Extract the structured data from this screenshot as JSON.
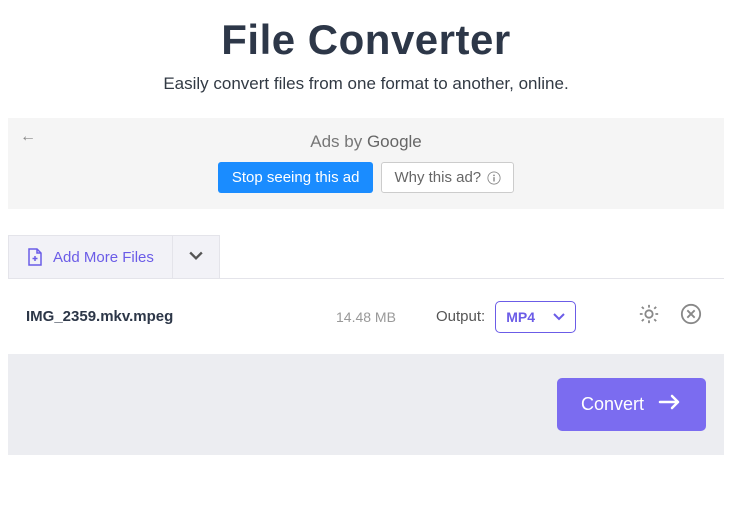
{
  "header": {
    "title": "File Converter",
    "subtitle": "Easily convert files from one format to another, online."
  },
  "ad": {
    "ads_by": "Ads by ",
    "google": "Google",
    "stop_label": "Stop seeing this ad",
    "why_label": "Why this ad?"
  },
  "toolbar": {
    "add_more": "Add More Files"
  },
  "file": {
    "name": "IMG_2359.mkv.mpeg",
    "size": "14.48 MB",
    "output_label": "Output:",
    "format": "MP4"
  },
  "footer": {
    "convert_label": "Convert"
  }
}
